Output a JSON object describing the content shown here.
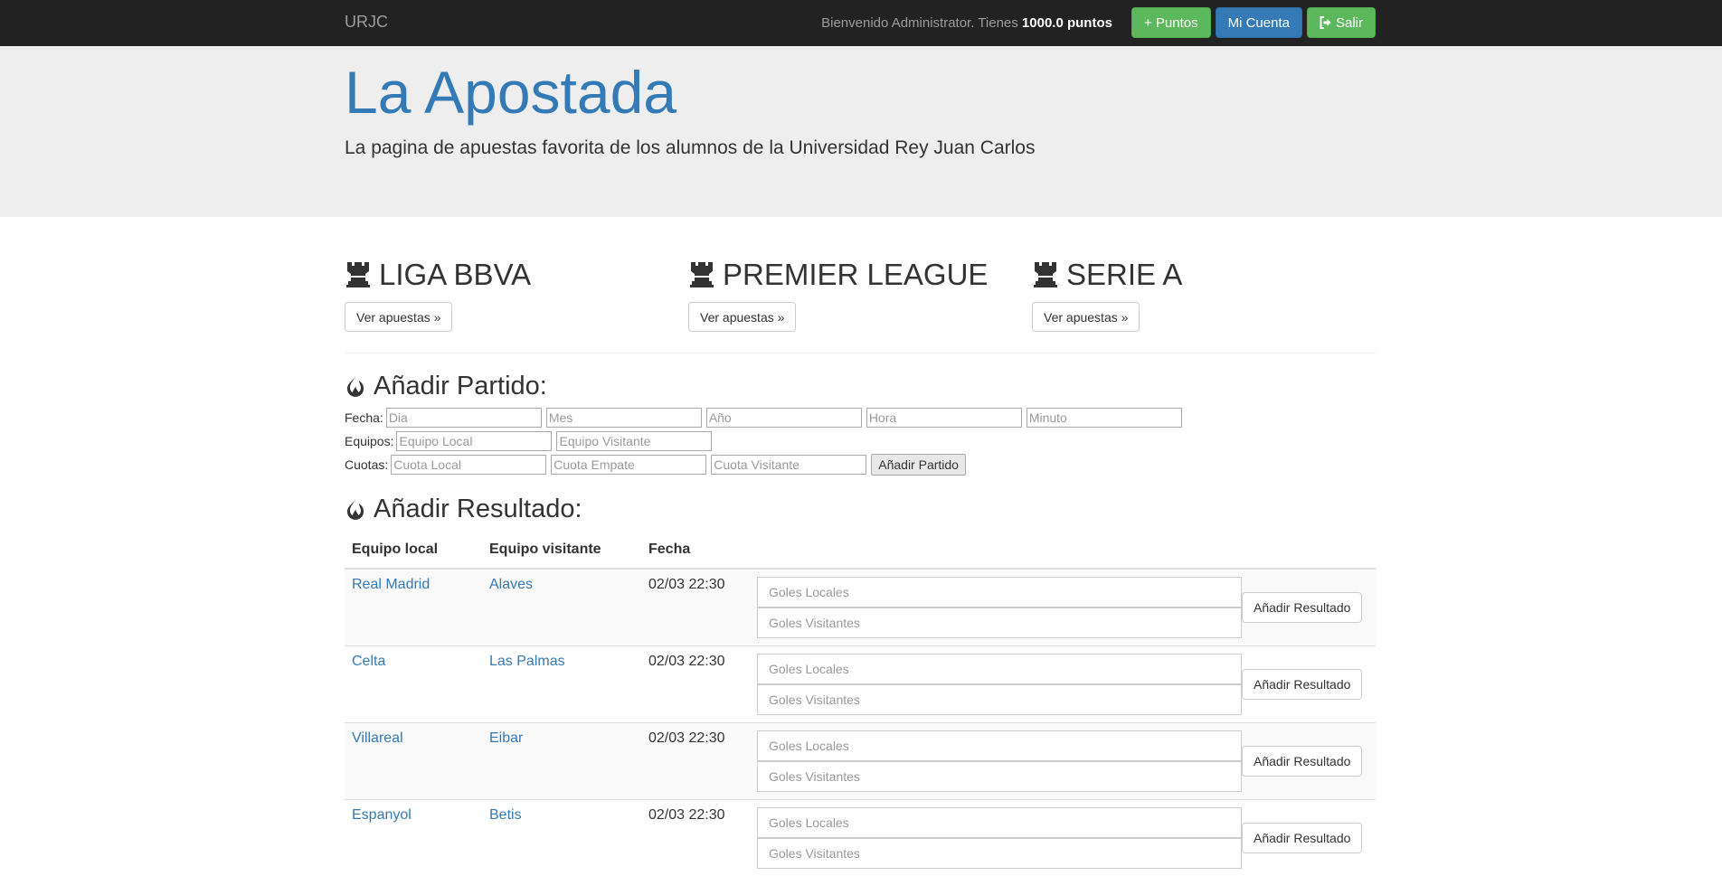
{
  "navbar": {
    "brand": "URJC",
    "welcome_prefix": "Bienvenido Administrator. Tienes ",
    "points": "1000.0 puntos",
    "buttons": {
      "points": "+ Puntos",
      "account": "Mi Cuenta",
      "logout": "Salir"
    },
    "logout_icon": "log-out-icon"
  },
  "jumbotron": {
    "title": "La Apostada",
    "subtitle": "La pagina de apuestas favorita de los alumnos de la Universidad Rey Juan Carlos"
  },
  "leagues": [
    {
      "name": "LIGA BBVA",
      "icon": "rook-icon",
      "button": "Ver apuestas »"
    },
    {
      "name": "PREMIER LEAGUE",
      "icon": "rook-icon",
      "button": "Ver apuestas »"
    },
    {
      "name": "SERIE A",
      "icon": "rook-icon",
      "button": "Ver apuestas »"
    }
  ],
  "add_match": {
    "title": "Añadir Partido:",
    "icon": "fire-icon",
    "fecha_label": "Fecha:",
    "fecha_placeholders": [
      "Dia",
      "Mes",
      "Año",
      "Hora",
      "Minuto"
    ],
    "equipos_label": "Equipos:",
    "equipos_placeholders": [
      "Equipo Local",
      "Equipo Visitante"
    ],
    "cuotas_label": "Cuotas:",
    "cuotas_placeholders": [
      "Cuota Local",
      "Cuota Empate",
      "Cuota Visitante"
    ],
    "submit": "Añadir Partido"
  },
  "add_result": {
    "title": "Añadir Resultado:",
    "icon": "fire-icon",
    "columns": [
      "Equipo local",
      "Equipo visitante",
      "Fecha"
    ],
    "goals_local_placeholder": "Goles Locales",
    "goals_visit_placeholder": "Goles Visitantes",
    "submit": "Añadir Resultado",
    "rows": [
      {
        "local": "Real Madrid",
        "visitante": "Alaves",
        "fecha": "02/03 22:30"
      },
      {
        "local": "Celta",
        "visitante": "Las Palmas",
        "fecha": "02/03 22:30"
      },
      {
        "local": "Villareal",
        "visitante": "Eibar",
        "fecha": "02/03 22:30"
      },
      {
        "local": "Espanyol",
        "visitante": "Betis",
        "fecha": "02/03 22:30"
      }
    ]
  }
}
